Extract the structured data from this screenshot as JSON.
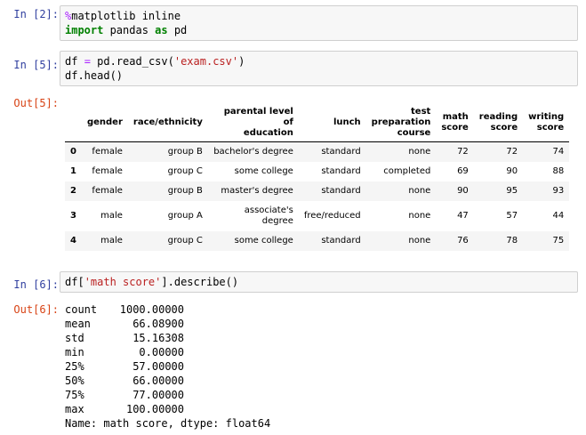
{
  "cells": [
    {
      "prompt": "In [2]:",
      "lines": [
        [
          {
            "t": "%",
            "c": "magic"
          },
          {
            "t": "matplotlib inline",
            "c": ""
          }
        ],
        [
          {
            "t": "import",
            "c": "kw"
          },
          {
            "t": " pandas ",
            "c": ""
          },
          {
            "t": "as",
            "c": "kw"
          },
          {
            "t": " pd",
            "c": ""
          }
        ]
      ]
    },
    {
      "prompt": "In [5]:",
      "lines": [
        [
          {
            "t": "df ",
            "c": ""
          },
          {
            "t": "=",
            "c": "op"
          },
          {
            "t": " pd.read_csv(",
            "c": ""
          },
          {
            "t": "'exam.csv'",
            "c": "str"
          },
          {
            "t": ")",
            "c": ""
          }
        ],
        [
          {
            "t": "df.head()",
            "c": ""
          }
        ]
      ]
    },
    {
      "prompt": "In [6]:",
      "lines": [
        [
          {
            "t": "df[",
            "c": ""
          },
          {
            "t": "'math score'",
            "c": "str"
          },
          {
            "t": "].describe()",
            "c": ""
          }
        ]
      ]
    }
  ],
  "outputs": {
    "out5_prompt": "Out[5]:",
    "out6_prompt": "Out[6]:"
  },
  "dataframe": {
    "columns": [
      [
        "",
        ""
      ],
      [
        "gender"
      ],
      [
        "race/ethnicity"
      ],
      [
        "parental level of",
        "education"
      ],
      [
        "lunch"
      ],
      [
        "test",
        "preparation",
        "course"
      ],
      [
        "math",
        "score"
      ],
      [
        "reading",
        "score"
      ],
      [
        "writing",
        "score"
      ]
    ],
    "rows": [
      {
        "index": "0",
        "cells": [
          "female",
          "group B",
          "bachelor's degree",
          "standard",
          "none",
          "72",
          "72",
          "74"
        ]
      },
      {
        "index": "1",
        "cells": [
          "female",
          "group C",
          "some college",
          "standard",
          "completed",
          "69",
          "90",
          "88"
        ]
      },
      {
        "index": "2",
        "cells": [
          "female",
          "group B",
          "master's degree",
          "standard",
          "none",
          "90",
          "95",
          "93"
        ]
      },
      {
        "index": "3",
        "cells": [
          "male",
          "group A",
          "associate's degree",
          "free/reduced",
          "none",
          "47",
          "57",
          "44"
        ]
      },
      {
        "index": "4",
        "cells": [
          "male",
          "group C",
          "some college",
          "standard",
          "none",
          "76",
          "78",
          "75"
        ]
      }
    ]
  },
  "describe": {
    "stats": [
      [
        "count",
        "1000.00000"
      ],
      [
        "mean",
        "66.08900"
      ],
      [
        "std",
        "15.16308"
      ],
      [
        "min",
        "0.00000"
      ],
      [
        "25%",
        "57.00000"
      ],
      [
        "50%",
        "66.00000"
      ],
      [
        "75%",
        "77.00000"
      ],
      [
        "max",
        "100.00000"
      ]
    ],
    "footer": "Name: math score, dtype: float64"
  }
}
